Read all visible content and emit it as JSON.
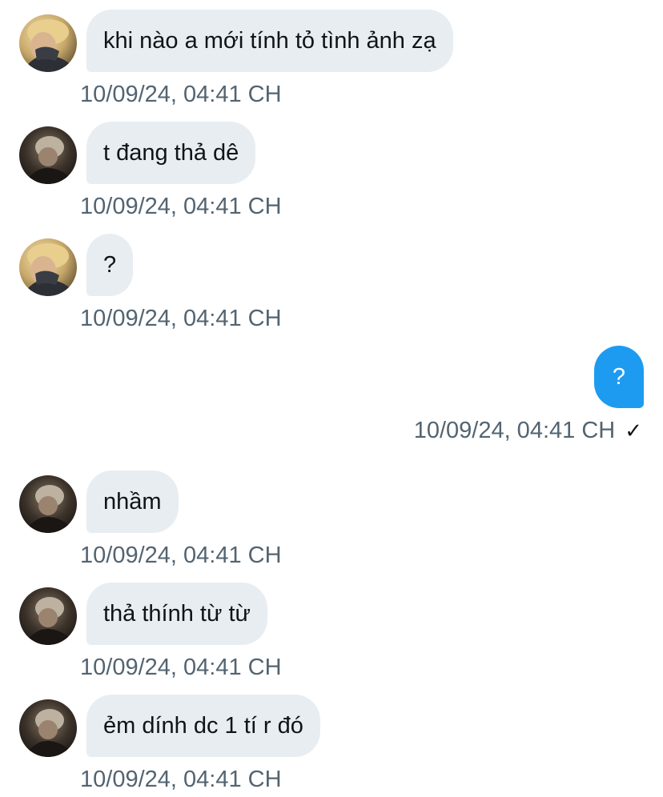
{
  "conversation": {
    "messages": [
      {
        "text": "khi nào a mới tính tỏ tình ảnh zạ",
        "time": "10/09/24, 04:41 CH"
      },
      {
        "text": "t đang thả dê",
        "time": "10/09/24, 04:41 CH"
      },
      {
        "text": "?",
        "time": "10/09/24, 04:41 CH"
      },
      {
        "text": "?",
        "time": "10/09/24, 04:41 CH",
        "status": "✓"
      },
      {
        "text": "nhầm",
        "time": "10/09/24, 04:41 CH"
      },
      {
        "text": "thả thính từ từ",
        "time": "10/09/24, 04:41 CH"
      },
      {
        "text": "ẻm dính dc 1 tí r đó",
        "time": "10/09/24, 04:41 CH"
      }
    ]
  },
  "colors": {
    "incoming_bubble": "#e8edf1",
    "outgoing_bubble": "#1d9bf0",
    "timestamp": "#536471",
    "text": "#0f1419"
  },
  "icons": {
    "avatar_a": "blonde-person-avatar",
    "avatar_b": "dark-person-avatar",
    "sent_status": "check-icon"
  }
}
